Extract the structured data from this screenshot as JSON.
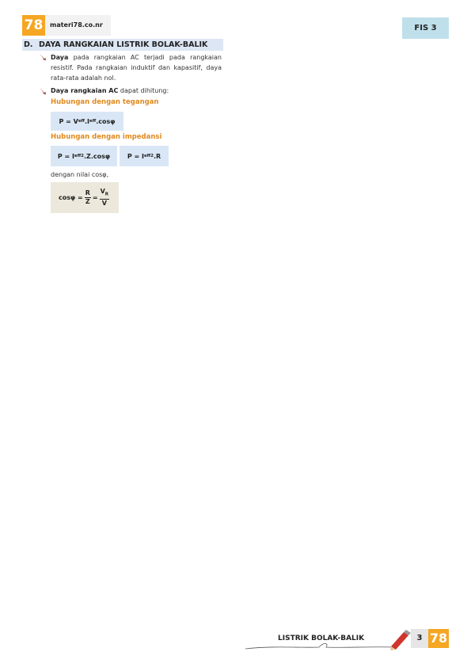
{
  "header": {
    "logo_number": "78",
    "site": "materi78.co.nr",
    "subject": "FIS 3"
  },
  "section": {
    "letter": "D.",
    "title": "DAYA RANGKAIAN LISTRIK BOLAK-BALIK"
  },
  "bullet1": {
    "bold": "Daya",
    "text": " pada rangkaian AC terjadi pada rangkaian resistif. Pada rangkaian induktif dan kapasitif, daya rata-rata adalah nol."
  },
  "bullet2": {
    "bold": "Daya rangkaian AC",
    "text": " dapat dihitung:"
  },
  "sub1": "Hubungan dengan tegangan",
  "formula1": {
    "p": "P = V",
    "eff1": "eff",
    "dot": ".I",
    "eff2": "eff",
    "cos": ".cosφ"
  },
  "sub2": "Hubungan dengan impedansi",
  "formula2": {
    "p": "P = I",
    "eff": "eff",
    "sq": "2",
    "rest": ".Z.cosφ"
  },
  "formula3": {
    "p": "P = I",
    "eff": "eff",
    "sq": "2",
    "rest": ".R"
  },
  "note": "dengan nilai cosφ,",
  "formula4": {
    "lhs": "cosφ =",
    "num1": "R",
    "den1": "Z",
    "eq": "=",
    "num2": "V",
    "num2sub": "R",
    "den2": "V"
  },
  "footer": {
    "title": "LISTRIK BOLAK-BALIK",
    "page": "3",
    "logo_number": "78"
  },
  "colors": {
    "orange": "#f5a623",
    "subhead_orange": "#e08a1e",
    "formula_blue": "#d9e6f5",
    "formula_beige": "#ece8dc",
    "subject_blue": "#bfe0ea"
  }
}
